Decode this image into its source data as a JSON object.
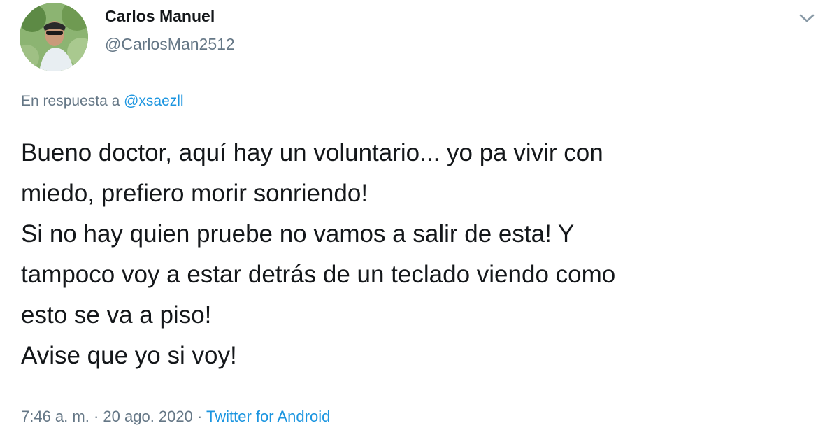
{
  "author": {
    "name": "Carlos Manuel",
    "handle": "@CarlosMan2512",
    "avatar_icon": "profile-photo"
  },
  "menu": {
    "icon": "chevron-down-icon"
  },
  "reply": {
    "prefix": "En respuesta a ",
    "mention": "@xsaezll"
  },
  "tweet": {
    "text": "Bueno doctor, aquí hay un voluntario... yo pa vivir con\nmiedo, prefiero morir sonriendo!\nSi no hay quien pruebe no vamos a salir de esta! Y\ntampoco voy a estar detrás de un teclado viendo como\nesto se va a piso!\nAvise que yo si voy!"
  },
  "meta": {
    "time": "7:46 a. m.",
    "separator": " · ",
    "date": "20 ago. 2020",
    "source": "Twitter for Android"
  },
  "colors": {
    "text": "#14171a",
    "secondary": "#657786",
    "link": "#1b95e0"
  }
}
